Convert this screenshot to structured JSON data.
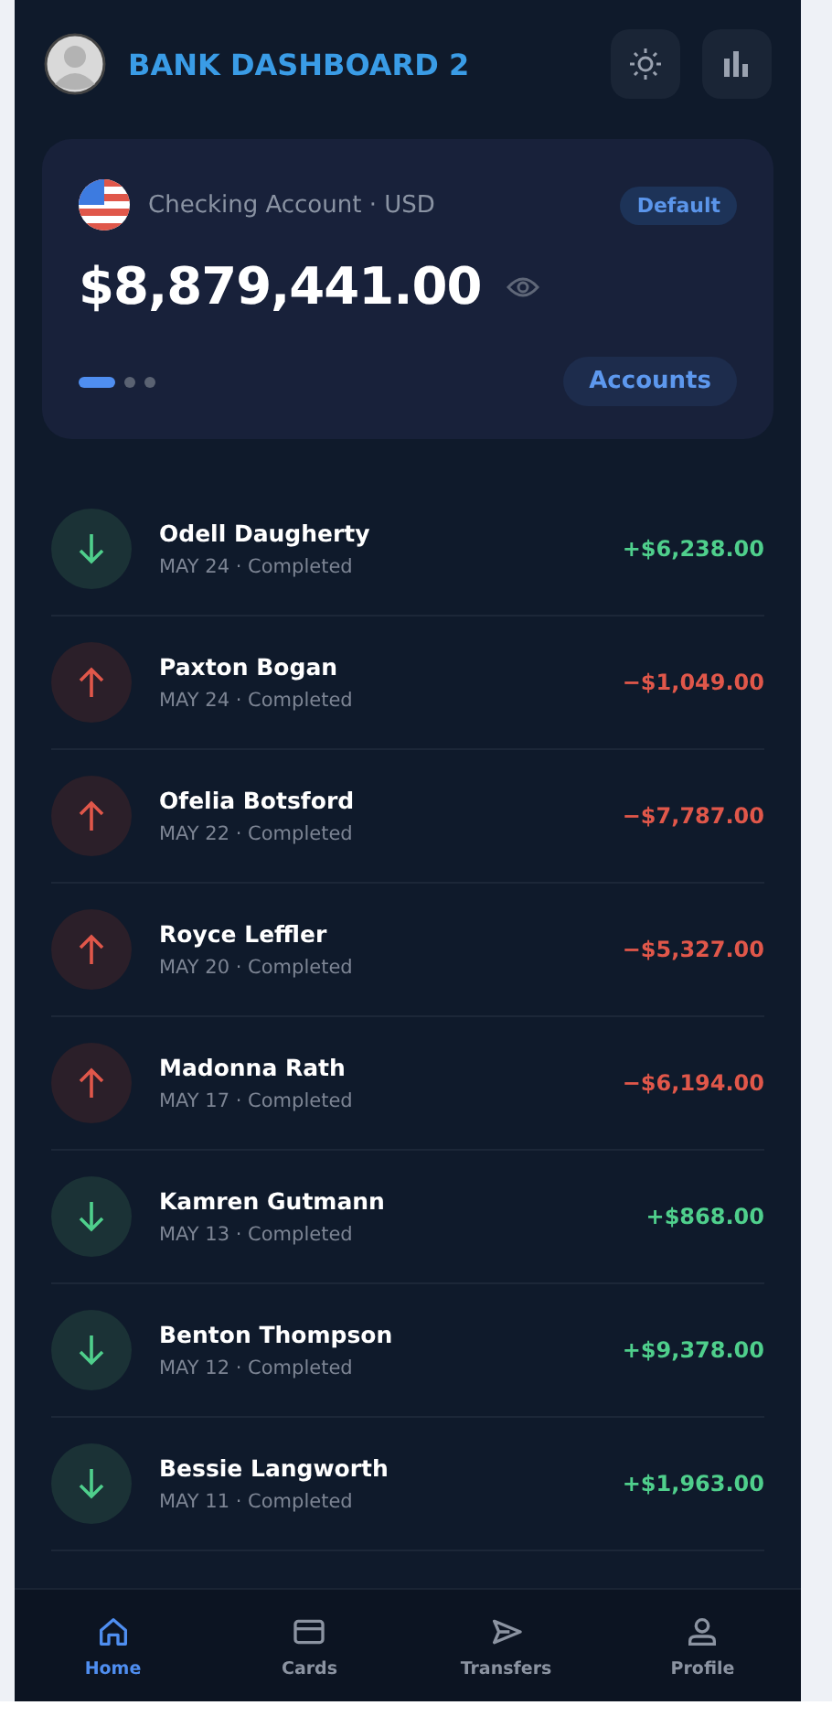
{
  "header": {
    "title": "BANK DASHBOARD 2"
  },
  "account": {
    "name": "Checking Account · USD",
    "badge": "Default",
    "balance": "$8,879,441.00",
    "pages": [
      {
        "selected": true
      },
      {
        "selected": false
      },
      {
        "selected": false
      }
    ],
    "button": "Accounts"
  },
  "transactions": [
    {
      "name": "Odell Daugherty",
      "meta": "MAY 24 · Completed",
      "amount": "+$6,238.00",
      "kind": "in"
    },
    {
      "name": "Paxton Bogan",
      "meta": "MAY 24 · Completed",
      "amount": "−$1,049.00",
      "kind": "out"
    },
    {
      "name": "Ofelia Botsford",
      "meta": "MAY 22 · Completed",
      "amount": "−$7,787.00",
      "kind": "out"
    },
    {
      "name": "Royce Leffler",
      "meta": "MAY 20 · Completed",
      "amount": "−$5,327.00",
      "kind": "out"
    },
    {
      "name": "Madonna Rath",
      "meta": "MAY 17 · Completed",
      "amount": "−$6,194.00",
      "kind": "out"
    },
    {
      "name": "Kamren Gutmann",
      "meta": "MAY 13 · Completed",
      "amount": "+$868.00",
      "kind": "in"
    },
    {
      "name": "Benton Thompson",
      "meta": "MAY 12 · Completed",
      "amount": "+$9,378.00",
      "kind": "in"
    },
    {
      "name": "Bessie Langworth",
      "meta": "MAY 11 · Completed",
      "amount": "+$1,963.00",
      "kind": "in"
    }
  ],
  "nav": [
    {
      "label": "Home",
      "kind": "home",
      "selected": true
    },
    {
      "label": "Cards",
      "kind": "cards",
      "selected": false
    },
    {
      "label": "Transfers",
      "kind": "transfers",
      "selected": false
    },
    {
      "label": "Profile",
      "kind": "profile",
      "selected": false
    }
  ]
}
